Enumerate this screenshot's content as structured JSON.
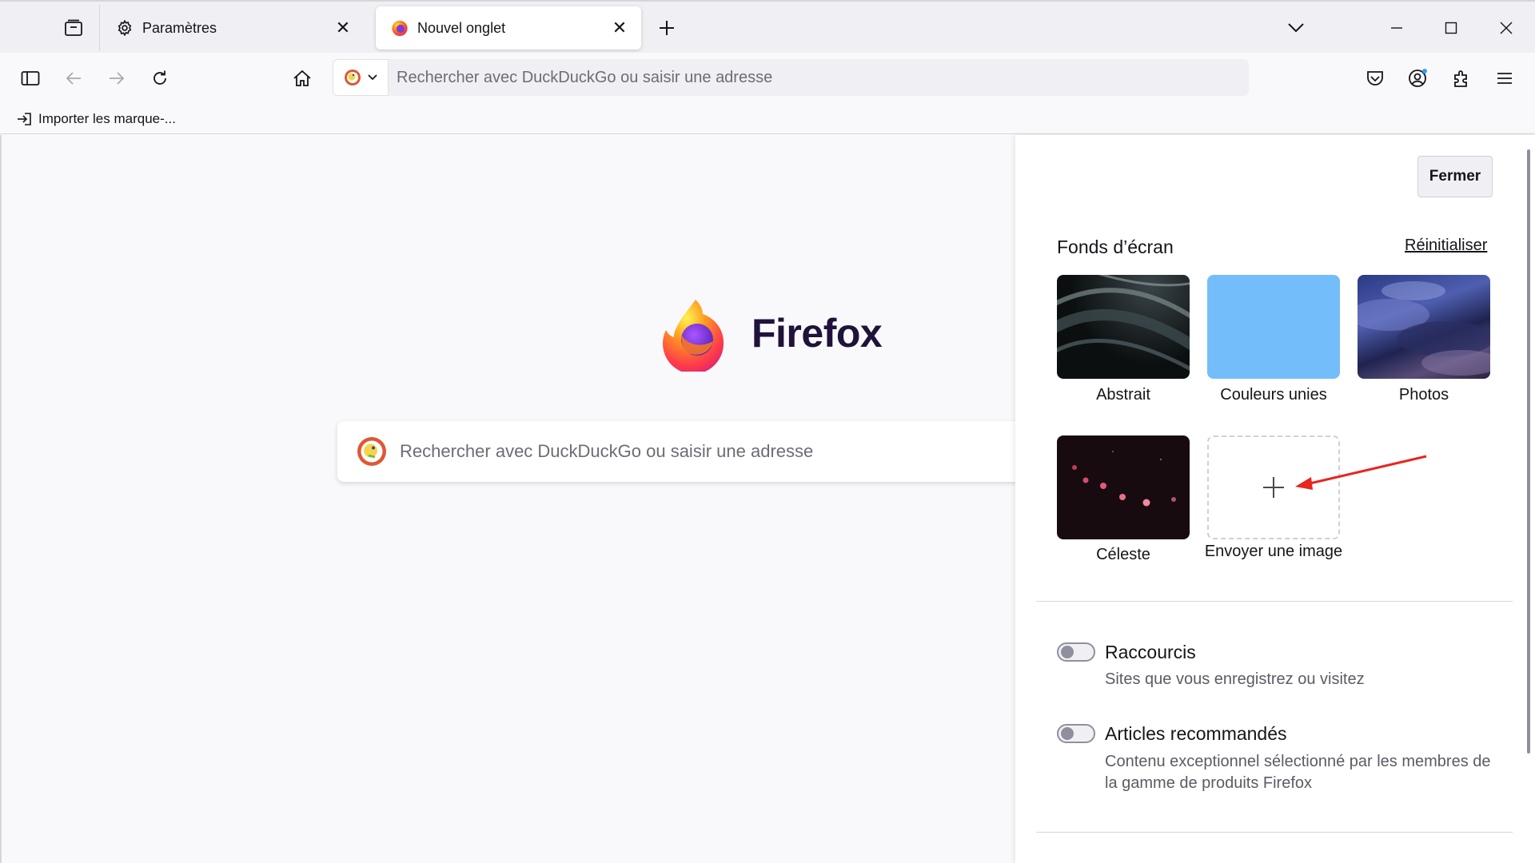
{
  "tabs": {
    "settings": {
      "label": "Paramètres",
      "icon": "gear-icon"
    },
    "active": {
      "label": "Nouvel onglet",
      "icon": "firefox-logo-icon"
    }
  },
  "navbar": {
    "search_placeholder": "Rechercher avec DuckDuckGo ou saisir une adresse",
    "engine_icon": "duckduckgo-icon"
  },
  "bookmarks": {
    "import_label": "Importer les marque-..."
  },
  "newtab": {
    "brand": "Firefox",
    "search_placeholder": "Rechercher avec DuckDuckGo ou saisir une adresse"
  },
  "panel": {
    "close_label": "Fermer",
    "wallpapers_heading": "Fonds d’écran",
    "reset_label": "Réinitialiser",
    "wallpapers": [
      {
        "label": "Abstrait"
      },
      {
        "label": "Couleurs unies"
      },
      {
        "label": "Photos"
      },
      {
        "label": "Céleste"
      },
      {
        "label": "Envoyer une image"
      }
    ],
    "options": [
      {
        "title": "Raccourcis",
        "description": "Sites que vous enregistrez ou visitez",
        "enabled": false
      },
      {
        "title": "Articles recommandés",
        "description": "Contenu exceptionnel sélectionné par les membres de la gamme de produits Firefox",
        "enabled": false
      }
    ]
  },
  "colors": {
    "accent_annotation": "#e8251e",
    "solid_wallpaper": "#73bdfb",
    "brand_text": "#20123a"
  }
}
